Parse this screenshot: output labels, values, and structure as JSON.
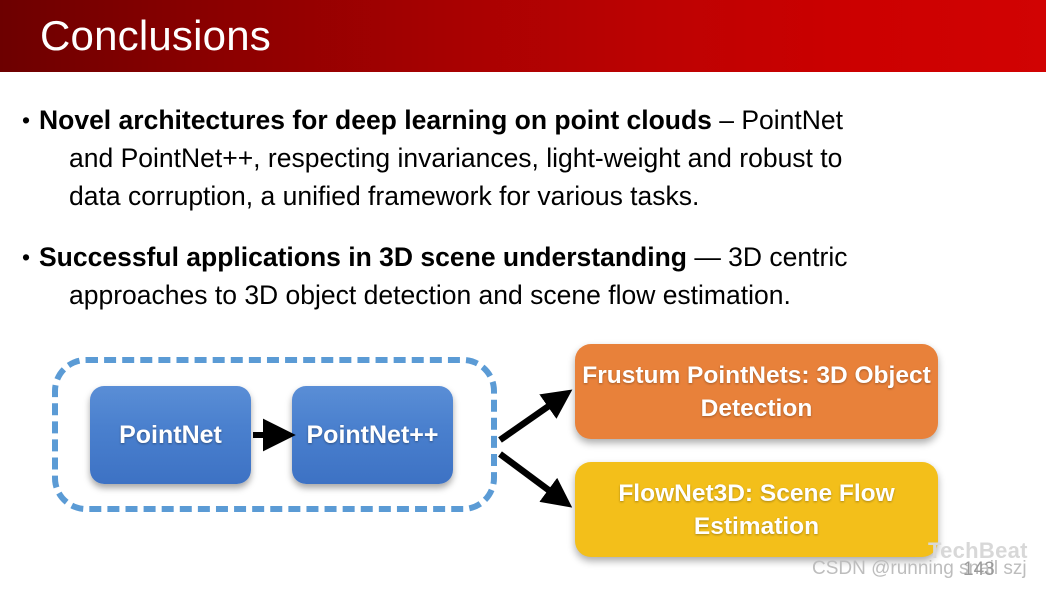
{
  "header": {
    "title": "Conclusions",
    "gradient_from": "#6d0000",
    "gradient_to": "#d10303"
  },
  "bullets": [
    {
      "marker": "•",
      "lead": "Novel architectures for deep learning on point clouds",
      "rest_first_line": " – PointNet",
      "lines": [
        "and PointNet++, respecting invariances, light-weight and robust to",
        "data corruption, a unified framework for various tasks."
      ]
    },
    {
      "marker": "•",
      "lead": "Successful applications in 3D scene understanding",
      "rest_first_line": " — 3D centric",
      "lines": [
        "approaches to 3D object detection and scene flow estimation."
      ]
    }
  ],
  "diagram": {
    "group_border_color": "#5b9bd5",
    "nodes": {
      "pointnet": "PointNet",
      "pointnetpp": "PointNet++",
      "frustum": "Frustum PointNets: 3D Object Detection",
      "flownet": "FlowNet3D: Scene Flow Estimation"
    },
    "colors": {
      "blue": "#4a80ce",
      "orange": "#e8813a",
      "yellow": "#f3bf1a",
      "arrow": "#000000"
    }
  },
  "watermarks": {
    "techbeat": "TechBeat",
    "csdn": "CSDN @running snail szj",
    "page_number": "143"
  }
}
